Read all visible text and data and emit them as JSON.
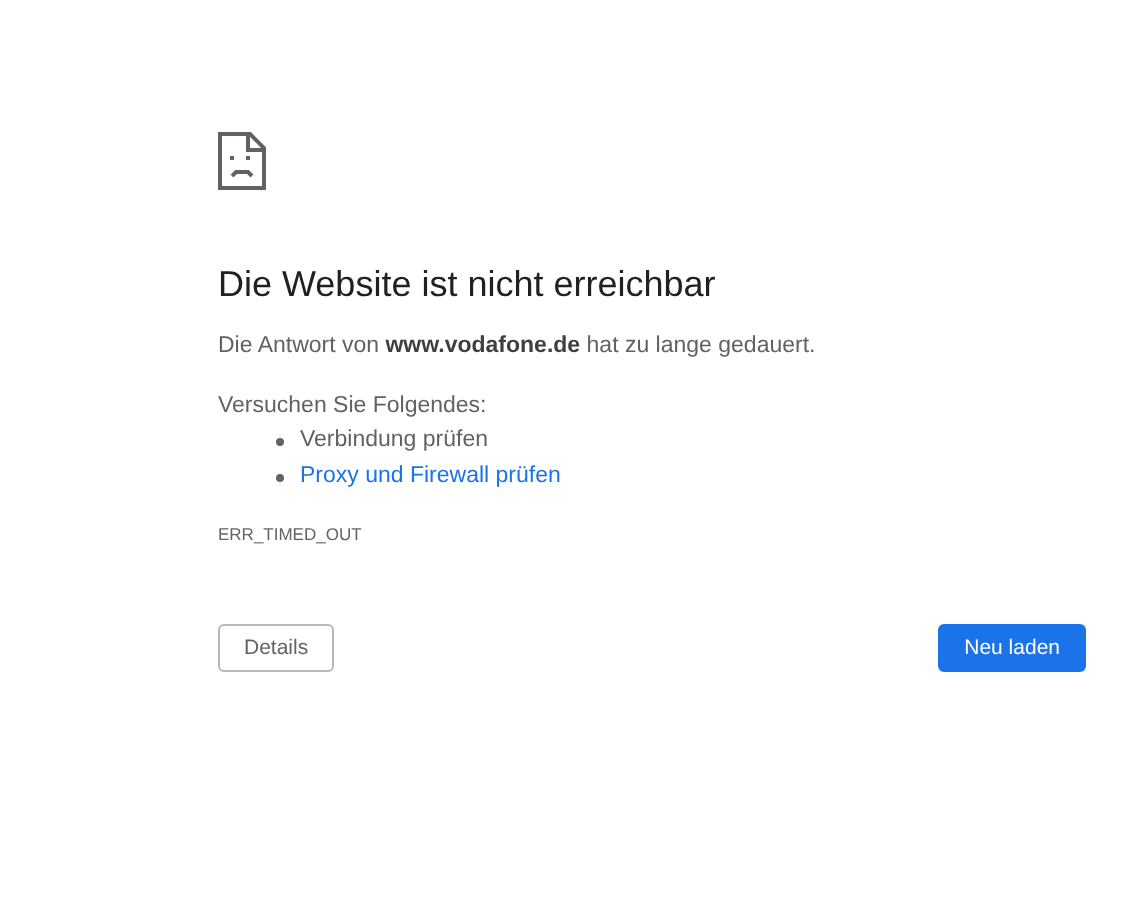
{
  "heading": "Die Website ist nicht erreichbar",
  "message": "Die Antwort von **www.vodafone.de** hat zu lange gedauert.",
  "suggestions_title": "Versuchen Sie Folgendes:",
  "suggestions": [
    {
      "kind": "text",
      "label": "Verbindung prüfen"
    },
    {
      "kind": "link",
      "label": "Proxy und Firewall prüfen"
    }
  ],
  "error_code": "ERR_TIMED_OUT",
  "buttons": {
    "details": "Details",
    "reload": "Neu laden"
  }
}
